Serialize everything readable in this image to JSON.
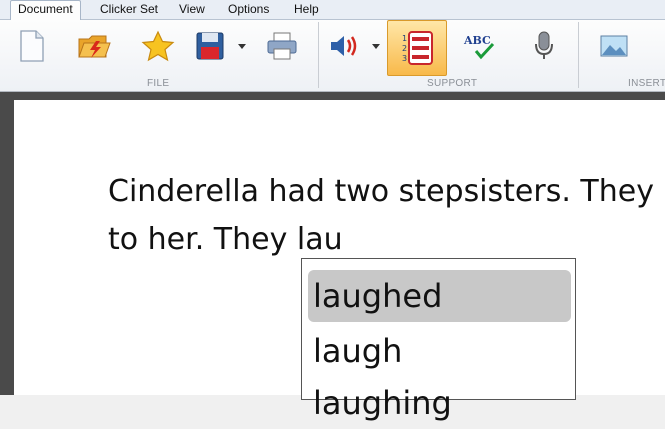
{
  "menu": {
    "items": [
      "Document",
      "Clicker Set",
      "View",
      "Options",
      "Help"
    ]
  },
  "ribbon": {
    "groups": {
      "file": "FILE",
      "support": "SUPPORT",
      "insert": "INSERT"
    },
    "spellcheck_text": "ABC"
  },
  "document": {
    "lines": [
      "Cinderella had two stepsisters. They",
      "to her. They lau"
    ]
  },
  "prediction": {
    "items": [
      "laughed",
      "laugh",
      "laughing"
    ],
    "selected_index": 0
  },
  "colors": {
    "selected_tool": "#f8b94a",
    "selected_prediction": "#c8c8c8"
  }
}
